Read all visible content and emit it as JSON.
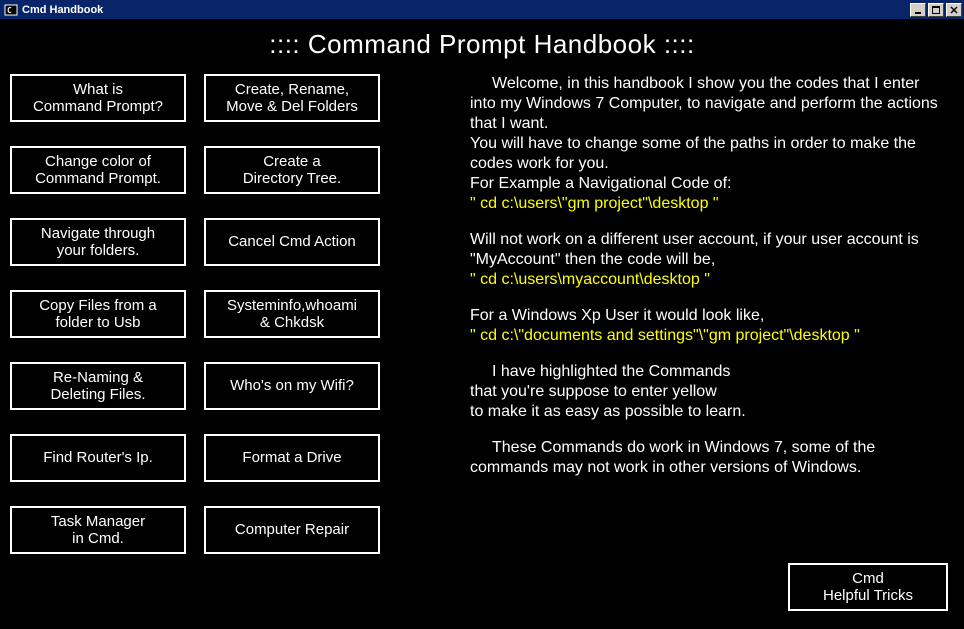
{
  "window": {
    "title": "Cmd Handbook"
  },
  "heading": "::::   Command Prompt Handbook   ::::",
  "buttons": [
    {
      "id": "what-is",
      "label": "What is\nCommand Prompt?"
    },
    {
      "id": "create-folders",
      "label": "Create, Rename,\nMove & Del Folders"
    },
    {
      "id": "change-color",
      "label": "Change color of\nCommand Prompt."
    },
    {
      "id": "dir-tree",
      "label": "Create a\nDirectory Tree."
    },
    {
      "id": "navigate",
      "label": "Navigate through\nyour folders."
    },
    {
      "id": "cancel",
      "label": "Cancel Cmd Action"
    },
    {
      "id": "copy-usb",
      "label": "Copy Files from a\nfolder to Usb"
    },
    {
      "id": "sysinfo",
      "label": "Systeminfo,whoami\n& Chkdsk"
    },
    {
      "id": "rename-del",
      "label": "Re-Naming &\nDeleting Files."
    },
    {
      "id": "wifi",
      "label": "Who's on my Wifi?"
    },
    {
      "id": "router-ip",
      "label": "Find Router's Ip."
    },
    {
      "id": "format",
      "label": "Format a Drive"
    },
    {
      "id": "taskmgr",
      "label": "Task Manager\nin Cmd."
    },
    {
      "id": "repair",
      "label": "Computer Repair"
    }
  ],
  "tricks_button": "Cmd\nHelpful Tricks",
  "content": {
    "p1a": "Welcome, in this handbook I show you the codes that I enter into my Windows 7 Computer, to navigate and perform the actions that I want.",
    "p1b": "You will have to change some of the paths in order to make the codes work for you.",
    "p1c": "For Example a Navigational Code of:",
    "code1": "\" cd c:\\users\\\"gm project\"\\desktop \"",
    "p2a": "Will not work on a different user account, if your user account is \"MyAccount\" then the code will be,",
    "code2": "\" cd c:\\users\\myaccount\\desktop \"",
    "p3a": "For a Windows Xp User it would look like,",
    "code3": "\" cd c:\\\"documents and settings\"\\\"gm project\"\\desktop \"",
    "p4a": "I have highlighted the Commands",
    "p4b": "that you're suppose to enter yellow",
    "p4c": "to make it as easy as possible to learn.",
    "p5": "These Commands do work in Windows 7, some of the commands may not work in other versions of Windows."
  }
}
